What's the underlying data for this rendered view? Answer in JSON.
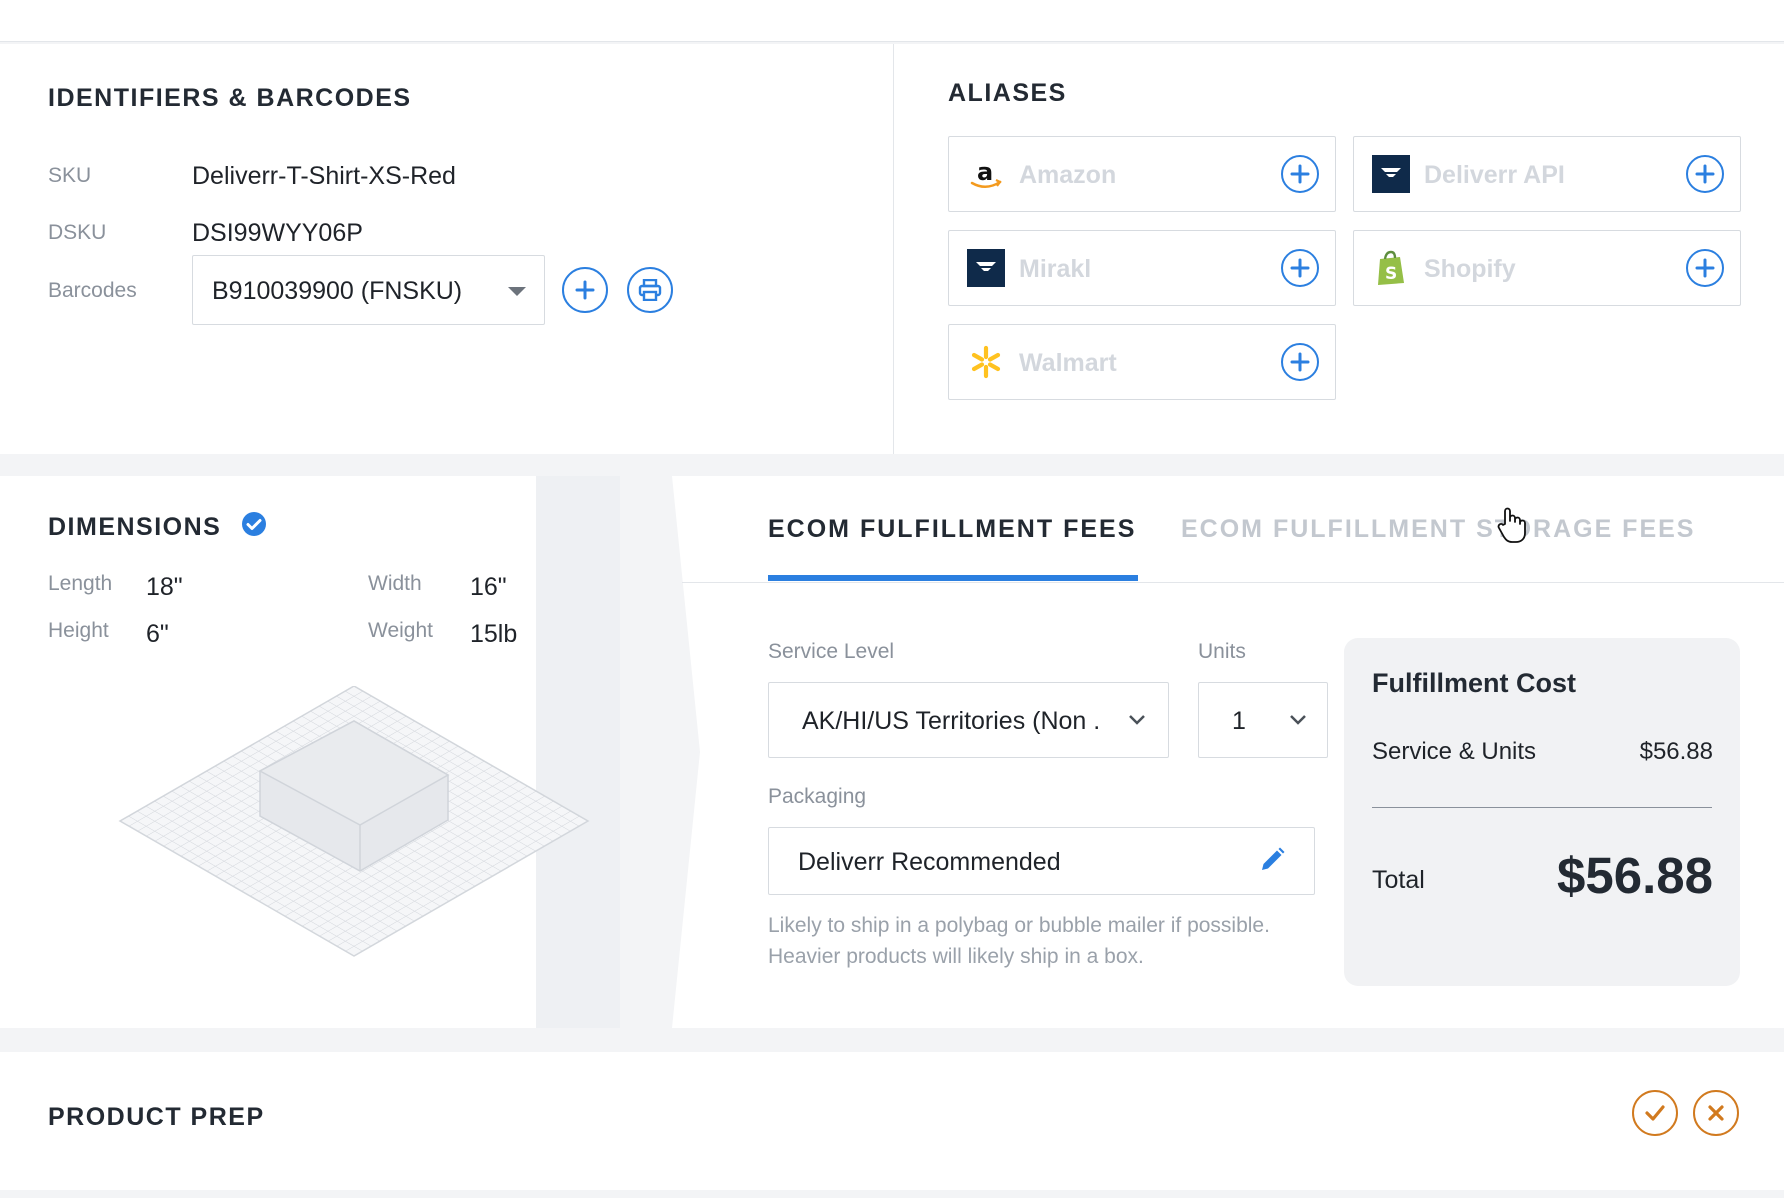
{
  "identifiers": {
    "heading": "IDENTIFIERS & BARCODES",
    "sku_label": "SKU",
    "sku_value": "Deliverr-T-Shirt-XS-Red",
    "dsku_label": "DSKU",
    "dsku_value": "DSI99WYY06P",
    "barcodes_label": "Barcodes",
    "barcode_selected": "B910039900 (FNSKU)"
  },
  "aliases": {
    "heading": "ALIASES",
    "items": [
      {
        "name": "Amazon",
        "icon": "amazon-logo-icon"
      },
      {
        "name": "Deliverr API",
        "icon": "deliverr-logo-icon"
      },
      {
        "name": "Mirakl",
        "icon": "mirakl-logo-icon"
      },
      {
        "name": "Shopify",
        "icon": "shopify-logo-icon"
      },
      {
        "name": "Walmart",
        "icon": "walmart-logo-icon"
      }
    ]
  },
  "dimensions": {
    "heading": "DIMENSIONS",
    "length_label": "Length",
    "length_value": "18\"",
    "width_label": "Width",
    "width_value": "16\"",
    "height_label": "Height",
    "height_value": "6\"",
    "weight_label": "Weight",
    "weight_value": "15lb"
  },
  "fees": {
    "tabs": [
      {
        "label": "ECOM FULFILLMENT FEES",
        "active": true
      },
      {
        "label": "ECOM FULFILLMENT STORAGE FEES",
        "active": false
      }
    ],
    "service_level_label": "Service Level",
    "service_level_value": "AK/HI/US Territories (Non .",
    "units_label": "Units",
    "units_value": "1",
    "packaging_label": "Packaging",
    "packaging_value": "Deliverr Recommended",
    "packaging_note_line1": "Likely to ship in a polybag or bubble mailer if possible.",
    "packaging_note_line2": "Heavier products will likely ship in a box."
  },
  "cost": {
    "title": "Fulfillment Cost",
    "service_units_label": "Service & Units",
    "service_units_value": "$56.88",
    "total_label": "Total",
    "total_value": "$56.88"
  },
  "product_prep": {
    "heading": "PRODUCT PREP"
  },
  "colors": {
    "accent": "#2b7fe0",
    "confirm_orange": "#d17a1f",
    "muted_text": "#8a919b",
    "cost_panel_bg": "#f1f2f4"
  }
}
